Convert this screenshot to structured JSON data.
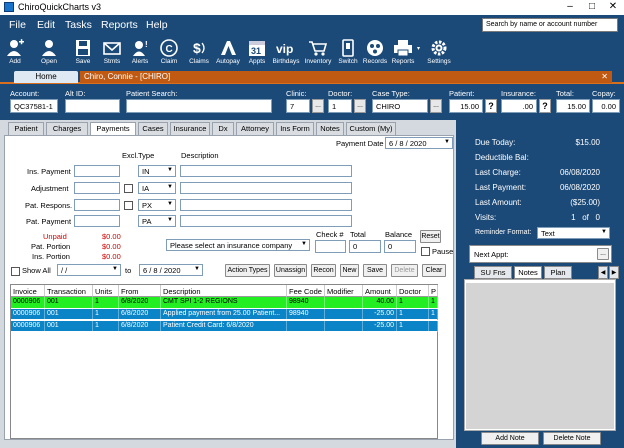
{
  "window": {
    "title": "ChiroQuickCharts v3"
  },
  "menu": [
    "File",
    "Edit",
    "Tasks",
    "Reports",
    "Help"
  ],
  "search": {
    "placeholder": "Search by name or account number"
  },
  "toolbar": [
    {
      "label": "Add",
      "icon": "add-person-icon"
    },
    {
      "label": "Open",
      "icon": "open-person-icon"
    },
    {
      "label": "Save",
      "icon": "floppy-disk-icon"
    },
    {
      "label": "Stmts",
      "icon": "envelope-icon"
    },
    {
      "label": "Alerts",
      "icon": "alert-icon"
    },
    {
      "label": "Claim",
      "icon": "claim-icon"
    },
    {
      "label": "Claims",
      "icon": "claims-icon"
    },
    {
      "label": "Autopay",
      "icon": "autopay-icon"
    },
    {
      "label": "Appts",
      "icon": "calendar-icon"
    },
    {
      "label": "Birthdays",
      "icon": "vip-icon",
      "glyph": "vip"
    },
    {
      "label": "Inventory",
      "icon": "cart-icon"
    },
    {
      "label": "Switch",
      "icon": "switch-icon"
    },
    {
      "label": "Records",
      "icon": "records-icon"
    },
    {
      "label": "Reports",
      "icon": "printer-icon"
    },
    {
      "label": "Settings",
      "icon": "gear-icon"
    }
  ],
  "tabs": {
    "home": "Home",
    "patient": "Chiro, Connie - [CHIRO]"
  },
  "info": {
    "account_label": "Account:",
    "account": "QC37581-1",
    "altid_label": "Alt ID:",
    "altid": "",
    "patient_search_label": "Patient Search:",
    "patient_search": "",
    "clinic_label": "Clinic:",
    "clinic": "7",
    "doctor_label": "Doctor:",
    "doctor": "1",
    "casetype_label": "Case Type:",
    "casetype": "CHIRO",
    "patient_label": "Patient:",
    "patient": "15.00",
    "insurance_label": "Insurance:",
    "insurance": ".00",
    "total_label": "Total:",
    "total": "15.00",
    "copay_label": "Copay:",
    "copay": "0.00"
  },
  "subtabs": [
    "Patient",
    "Charges",
    "Payments",
    "Cases",
    "Insurance",
    "Dx",
    "Attorney",
    "Ins Form",
    "Notes",
    "Custom (My)"
  ],
  "active_subtab": "Payments",
  "payment": {
    "date_label": "Payment Date",
    "date": "6 /  8 / 2020",
    "excl_label": "Excl.",
    "type_label": "Type",
    "desc_label": "Description",
    "rows": [
      {
        "label": "Ins. Payment",
        "type": "IN"
      },
      {
        "label": "Adjustment",
        "type": "IA"
      },
      {
        "label": "Pat. Respons.",
        "type": "PX"
      },
      {
        "label": "Pat. Payment",
        "type": "PA"
      }
    ],
    "unpaid_label": "Unpaid",
    "unpaid": "$0.00",
    "pat_portion_label": "Pat. Portion",
    "pat_portion": "$0.00",
    "ins_portion_label": "Ins. Portion",
    "ins_portion": "$0.00",
    "insurance_select": "Please select an insurance company",
    "check_label": "Check #",
    "check": "",
    "total_label": "Total",
    "total": "0",
    "balance_label": "Balance",
    "balance": "0",
    "reset_label": "Reset",
    "pause_label": "Pause",
    "show_all_label": "Show All",
    "from_date": "/     /",
    "to_label": "to",
    "to_date": "6 / 8 / 2020"
  },
  "actions": [
    "Action Types",
    "Unassign",
    "Recon",
    "New",
    "Save",
    "Delete",
    "Clear"
  ],
  "grid": {
    "headers": [
      "Invoice",
      "Transaction",
      "Units",
      "From",
      "Description",
      "Fee Code",
      "Modifier",
      "Amount",
      "Doctor",
      "P"
    ],
    "rows": [
      {
        "invoice": "0000906",
        "transaction": "001",
        "units": "1",
        "from": "6/8/2020",
        "description": "CMT SPI 1-2 REGIONS",
        "fee_code": "98940",
        "modifier": "",
        "amount": "40.00",
        "doctor": "1",
        "p": "1",
        "color": "#22ee22"
      },
      {
        "invoice": "0000906",
        "transaction": "001",
        "units": "1",
        "from": "6/8/2020",
        "description": "Applied payment from 25.00 Patient...",
        "fee_code": "98940",
        "modifier": "",
        "amount": "-25.00",
        "doctor": "1",
        "p": "1",
        "color": "#0a84c6"
      },
      {
        "invoice": "0000906",
        "transaction": "001",
        "units": "1",
        "from": "6/8/2020",
        "description": "Patient Credit Card: 6/8/2020",
        "fee_code": "",
        "modifier": "",
        "amount": "-25.00",
        "doctor": "1",
        "p": "",
        "color": "#0a84c6"
      }
    ]
  },
  "summary": [
    {
      "label": "Due Today:",
      "value": "$15.00"
    },
    {
      "label": "Deductible Bal:",
      "value": ""
    },
    {
      "label": "Last Charge:",
      "value": "06/08/2020"
    },
    {
      "label": "Last Payment:",
      "value": "06/08/2020"
    },
    {
      "label": "Last Amount:",
      "value": "($25.00)"
    },
    {
      "label": "Visits:",
      "value": "1   of   0"
    }
  ],
  "reminder": {
    "label": "Reminder Format:",
    "value": "Text"
  },
  "next_appt": {
    "label": "Next Appt:",
    "value": ""
  },
  "notes_tabs": [
    "SU Fns",
    "Notes",
    "Plan"
  ],
  "note_buttons": {
    "add": "Add Note",
    "delete": "Delete Note"
  },
  "colors": {
    "navy": "#1c4a78",
    "orange": "#c05a12",
    "green_row": "#22ee22",
    "blue_row": "#0a84c6"
  }
}
